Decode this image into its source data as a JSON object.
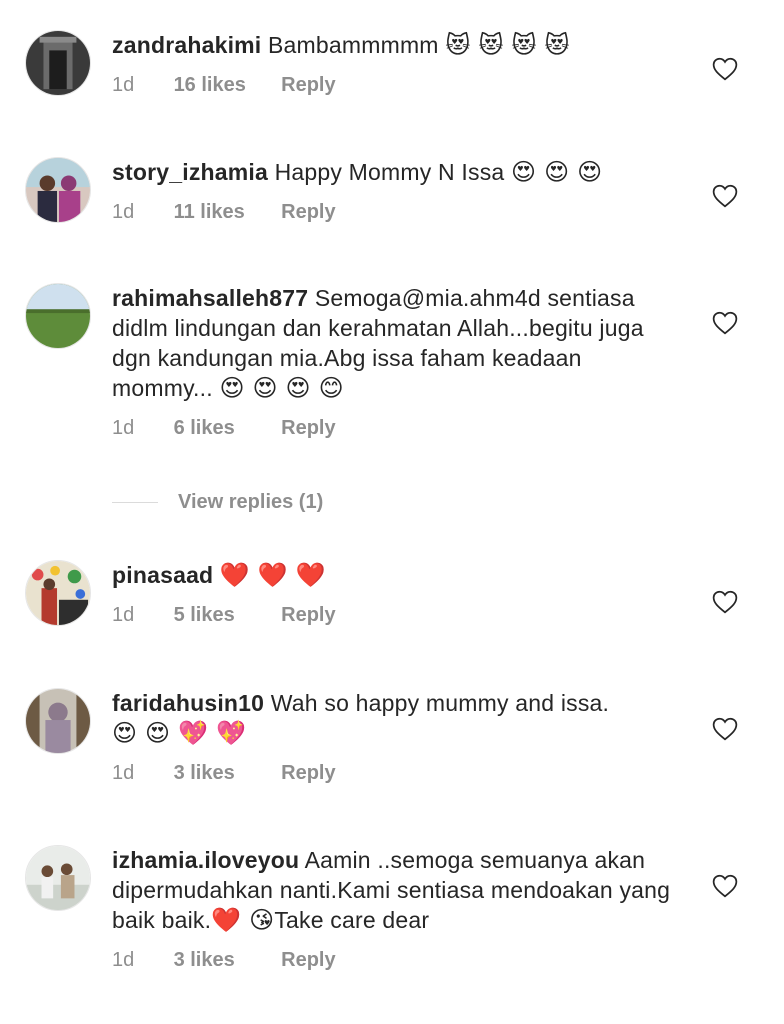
{
  "icons": {
    "like": "heart-outline-icon"
  },
  "colors": {
    "text": "#262626",
    "meta": "#8e8e8e",
    "divider": "#dbdbdb"
  },
  "comments": [
    {
      "username": "zandrahakimi",
      "text": "Bambammmmm",
      "emoji": "😻 😻 😻 😻",
      "time": "1d",
      "likes": "16 likes",
      "reply": "Reply"
    },
    {
      "username": "story_izhamia",
      "text": "Happy Mommy N Issa",
      "emoji": "😍 😍 😍",
      "time": "1d",
      "likes": "11 likes",
      "reply": "Reply"
    },
    {
      "username": "rahimahsalleh877",
      "text": "Semoga@mia.ahm4d sentiasa didlm lindungan dan kerahmatan Allah...begitu juga dgn kandungan mia.Abg issa faham keadaan mommy...",
      "emoji": "😍 😍 😍 😊",
      "time": "1d",
      "likes": "6 likes",
      "reply": "Reply"
    },
    {
      "username": "pinasaad",
      "text": "",
      "emoji": "❤️ ❤️ ❤️",
      "time": "1d",
      "likes": "5 likes",
      "reply": "Reply"
    },
    {
      "username": "faridahusin10",
      "text": "Wah so happy mummy and issa.",
      "emoji": "😍 😍 💖 💖",
      "time": "1d",
      "likes": "3 likes",
      "reply": "Reply"
    },
    {
      "username": "izhamia.iloveyou",
      "text": "Aamin ..semoga semuanya akan dipermudahkan nanti.Kami sentiasa mendoakan yang baik baik.",
      "emoji": "❤️ 😘",
      "text_after": "Take care dear",
      "time": "1d",
      "likes": "3 likes",
      "reply": "Reply"
    }
  ],
  "view_replies": "View replies (1)"
}
